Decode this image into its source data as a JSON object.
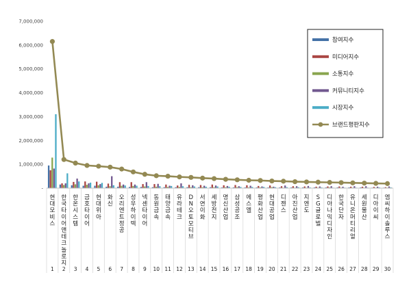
{
  "chart_data": {
    "type": "bar",
    "title": "",
    "xlabel": "",
    "ylabel": "",
    "ylim": [
      0,
      7000000
    ],
    "yticks": [
      0,
      1000000,
      2000000,
      3000000,
      4000000,
      5000000,
      6000000,
      7000000
    ],
    "ytick_labels": [
      "-",
      "1,000,000",
      "2,000,000",
      "3,000,000",
      "4,000,000",
      "5,000,000",
      "6,000,000",
      "7,000,000"
    ],
    "grid": false,
    "legend_position": "top-right",
    "categories": [
      "현대모비스",
      "한국타이어앤테크놀로지",
      "한온시스템",
      "금호타이어",
      "현대위아",
      "화신",
      "오리엔트정공",
      "성우하이텍",
      "넥센타이어",
      "동원금속",
      "태양금속",
      "유라테크",
      "DN오토모티브",
      "서연이화",
      "세방전지",
      "명신산업",
      "삼성공조",
      "에스엘",
      "평화산업",
      "현대공업",
      "디젠스",
      "아진산업",
      "지엔도",
      "SG글로벌",
      "디아나믹디자인",
      "한국단자",
      "유니온머티리얼",
      "세원물산",
      "디아이씨",
      "엠씨하이솔루스"
    ],
    "rank_numbers": [
      "1",
      "2",
      "3",
      "4",
      "5",
      "6",
      "7",
      "8",
      "9",
      "10",
      "11",
      "12",
      "13",
      "14",
      "15",
      "16",
      "17",
      "18",
      "19",
      "20",
      "21",
      "22",
      "23",
      "24",
      "25",
      "26",
      "27",
      "28",
      "29",
      "30"
    ],
    "series": [
      {
        "name": "참여지수",
        "kind": "bar",
        "color": "#4572a7",
        "values": [
          950000,
          150000,
          120000,
          100000,
          100000,
          60000,
          60000,
          50000,
          50000,
          40000,
          40000,
          40000,
          40000,
          40000,
          40000,
          30000,
          30000,
          30000,
          30000,
          30000,
          30000,
          30000,
          30000,
          30000,
          30000,
          30000,
          30000,
          30000,
          20000,
          20000
        ]
      },
      {
        "name": "미디어지수",
        "kind": "bar",
        "color": "#aa4643",
        "values": [
          750000,
          200000,
          260000,
          280000,
          270000,
          190000,
          250000,
          250000,
          170000,
          170000,
          150000,
          110000,
          140000,
          130000,
          150000,
          120000,
          130000,
          120000,
          90000,
          110000,
          80000,
          80000,
          70000,
          60000,
          70000,
          70000,
          60000,
          60000,
          50000,
          40000
        ]
      },
      {
        "name": "소통지수",
        "kind": "bar",
        "color": "#89a54e",
        "values": [
          1280000,
          130000,
          160000,
          140000,
          120000,
          80000,
          100000,
          90000,
          70000,
          60000,
          50000,
          50000,
          40000,
          40000,
          40000,
          40000,
          40000,
          30000,
          30000,
          40000,
          20000,
          20000,
          20000,
          20000,
          30000,
          20000,
          20000,
          20000,
          20000,
          20000
        ]
      },
      {
        "name": "커뮤니티지수",
        "kind": "bar",
        "color": "#71588f",
        "values": [
          820000,
          200000,
          400000,
          200000,
          170000,
          500000,
          150000,
          150000,
          250000,
          180000,
          100000,
          200000,
          120000,
          100000,
          110000,
          90000,
          80000,
          100000,
          70000,
          60000,
          110000,
          80000,
          90000,
          70000,
          80000,
          60000,
          80000,
          80000,
          60000,
          70000
        ]
      },
      {
        "name": "시장지수",
        "kind": "bar",
        "color": "#4bacc6",
        "values": [
          3100000,
          620000,
          280000,
          230000,
          220000,
          120000,
          110000,
          100000,
          90000,
          80000,
          90000,
          80000,
          70000,
          60000,
          70000,
          60000,
          50000,
          50000,
          50000,
          40000,
          40000,
          40000,
          30000,
          30000,
          20000,
          20000,
          20000,
          20000,
          30000,
          30000
        ]
      },
      {
        "name": "브랜드평판지수",
        "kind": "line",
        "color": "#938953",
        "values": [
          6150000,
          1200000,
          1050000,
          950000,
          920000,
          880000,
          800000,
          680000,
          580000,
          520000,
          500000,
          470000,
          450000,
          420000,
          400000,
          370000,
          350000,
          330000,
          320000,
          300000,
          290000,
          270000,
          260000,
          250000,
          240000,
          230000,
          220000,
          210000,
          200000,
          190000
        ]
      }
    ]
  }
}
